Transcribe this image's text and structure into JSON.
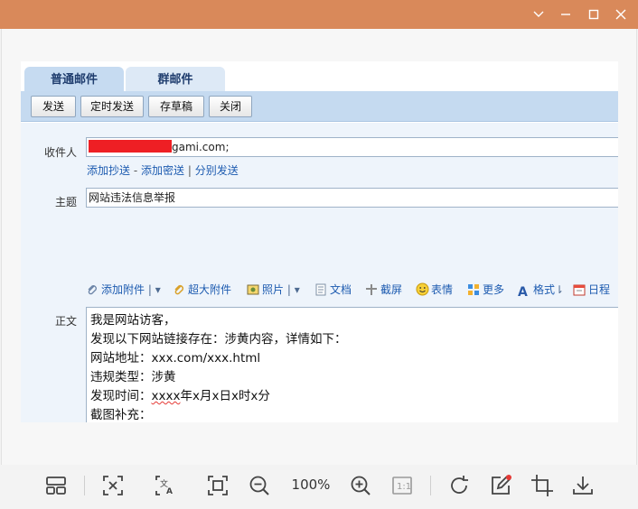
{
  "window": {
    "controls": [
      "chevron-down-icon",
      "minimize-icon",
      "maximize-icon",
      "close-icon"
    ],
    "accent_color": "#d9895a"
  },
  "email": {
    "tabs": [
      "普通邮件",
      "群邮件"
    ],
    "toolbar": {
      "send": "发送",
      "scheduled_send": "定时发送",
      "save_draft": "存草稿",
      "close": "关闭"
    },
    "recipient_label": "收件人",
    "recipient_value": "gami.com;",
    "links": {
      "add_cc": "添加抄送",
      "sep1": "-",
      "add_bcc": "添加密送",
      "sep2": "|",
      "separate_send": "分别发送"
    },
    "subject_label": "主题",
    "subject_value": "网站违法信息举报",
    "attach": {
      "add_attachment": "添加附件",
      "large_attachment": "超大附件",
      "photo": "照片",
      "document": "文档",
      "screenshot": "截屏",
      "emoji": "表情",
      "more": "更多",
      "format": "格式",
      "calendar": "日程"
    },
    "body_label": "正文",
    "body_lines": [
      "我是网站访客，",
      "发现以下网站链接存在：涉黄内容，详情如下：",
      "网站地址：xxx.com/xxx.html",
      "违规类型：涉黄",
      "发现时间：",
      "截图补充："
    ],
    "time_placeholder": "xxxx",
    "time_suffix": "年x月x日x时x分"
  },
  "viewer": {
    "zoom": "100%",
    "icons": [
      "layout-icon",
      "fit-icon",
      "ocr-translate-icon",
      "fullscreen-icon",
      "zoom-out-icon",
      "zoom-in-icon",
      "actual-size-icon",
      "rotate-icon",
      "edit-icon",
      "crop-icon",
      "download-icon"
    ]
  }
}
